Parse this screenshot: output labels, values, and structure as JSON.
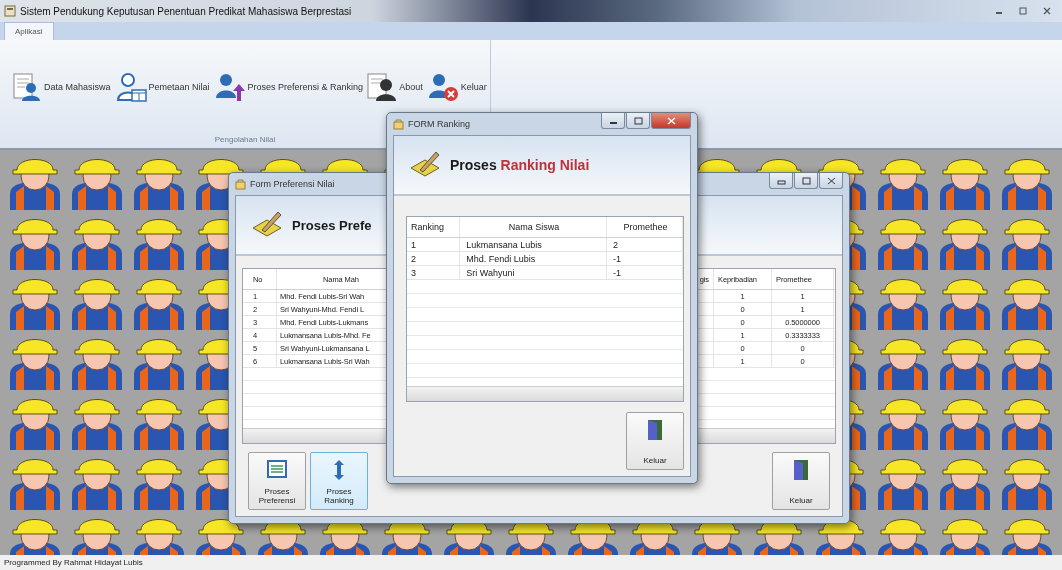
{
  "window": {
    "title": "Sistem Pendukung Keputusan Penentuan Predikat Mahasiswa Berprestasi"
  },
  "ribbon": {
    "tabs": [
      {
        "label": "Aplikasi",
        "selected": true
      }
    ],
    "items": [
      {
        "label": "Data Mahasiswa",
        "kind": "students"
      },
      {
        "label": "Pemetaan Nilai",
        "kind": "grades"
      },
      {
        "label": "Proses Preferensi & Ranking",
        "kind": "process"
      },
      {
        "label": "About",
        "kind": "about"
      },
      {
        "label": "Keluar",
        "kind": "exit"
      }
    ],
    "group_label": "Pengolahan Nilai"
  },
  "preferensi_window": {
    "title": "Form Preferensi Nilai",
    "header": "Proses Prefe",
    "columns": [
      "No",
      "Nama Mah",
      "gis",
      "Kepribadian",
      "Promethee"
    ],
    "rows": [
      {
        "no": "1",
        "name": "Mhd. Fendi Lubis-Sri Wah",
        "column_4": "1",
        "column_5": "1"
      },
      {
        "no": "2",
        "name": "Sri Wahyuni-Mhd. Fendi L",
        "column_4": "0",
        "column_5": "1"
      },
      {
        "no": "3",
        "name": "Mhd. Fendi Lubis-Lukmans",
        "column_4": "0",
        "column_5": "0.5000000"
      },
      {
        "no": "4",
        "name": "Lukmansana Lubis-Mhd. Fe",
        "column_4": "1",
        "column_5": "0.3333333"
      },
      {
        "no": "5",
        "name": "Sri Wahyuni-Lukmansana L",
        "column_4": "0",
        "column_5": "0"
      },
      {
        "no": "6",
        "name": "Lukmansana Lubis-Sri Wah",
        "column_4": "1",
        "column_5": "0"
      }
    ],
    "buttons": [
      {
        "label": "Proses Preferensi",
        "kind": "list",
        "selected": false
      },
      {
        "label": "Proses Ranking",
        "kind": "sort",
        "selected": true
      }
    ],
    "exit_button": "Keluar"
  },
  "ranking_window": {
    "title": "FORM Ranking",
    "header": {
      "lead": "Proses",
      "accent": "Ranking Nilai"
    },
    "columns": [
      "Ranking",
      "Nama Siswa",
      "Promethee"
    ],
    "rows": [
      {
        "ranking": "1",
        "name": "Lukmansana Lubis",
        "promethee": "2"
      },
      {
        "ranking": "2",
        "name": "Mhd. Fendi Lubis",
        "promethee": "-1"
      },
      {
        "ranking": "3",
        "name": "Sri Wahyuni",
        "promethee": "-1"
      }
    ],
    "exit_button": "Keluar"
  },
  "status_bar": "Programmed By Rahmat Hidayat Lubis"
}
